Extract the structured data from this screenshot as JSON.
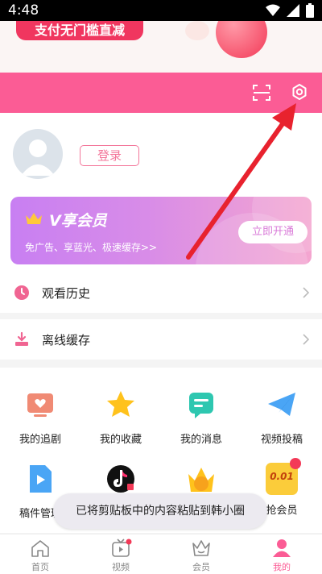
{
  "status_bar": {
    "time": "4:48"
  },
  "banner": {
    "button_label": "支付无门槛直减"
  },
  "profile": {
    "login_label": "登录"
  },
  "vip_card": {
    "title": "V享会员",
    "subtitle": "免广告、享蓝光、极速缓存>>",
    "open_button": "立即开通"
  },
  "menu_rows": [
    {
      "label": "观看历史",
      "icon": "clock-icon"
    },
    {
      "label": "离线缓存",
      "icon": "download-icon"
    }
  ],
  "grid_items": [
    {
      "label": "我的追剧",
      "icon": "tv-heart-icon"
    },
    {
      "label": "我的收藏",
      "icon": "star-icon"
    },
    {
      "label": "我的消息",
      "icon": "message-icon"
    },
    {
      "label": "视频投稿",
      "icon": "paper-plane-icon"
    },
    {
      "label": "稿件管理",
      "icon": "video-file-icon"
    },
    {
      "label": "",
      "icon": "tiktok-icon"
    },
    {
      "label": "",
      "icon": "vip-crown-icon"
    },
    {
      "label": "抢会员",
      "icon": "coupon-icon",
      "badge": "0.01"
    }
  ],
  "toast": {
    "message": "已将剪贴板中的内容粘贴到韩小圈"
  },
  "tabs": [
    {
      "label": "首页",
      "icon": "home-icon"
    },
    {
      "label": "视频",
      "icon": "video-tab-icon"
    },
    {
      "label": "会员",
      "icon": "crown-tab-icon"
    },
    {
      "label": "我的",
      "icon": "person-icon",
      "active": true
    }
  ],
  "colors": {
    "brand_pink": "#fb5c95",
    "accent_red": "#f0365f",
    "arrow_red": "#e8222e"
  }
}
